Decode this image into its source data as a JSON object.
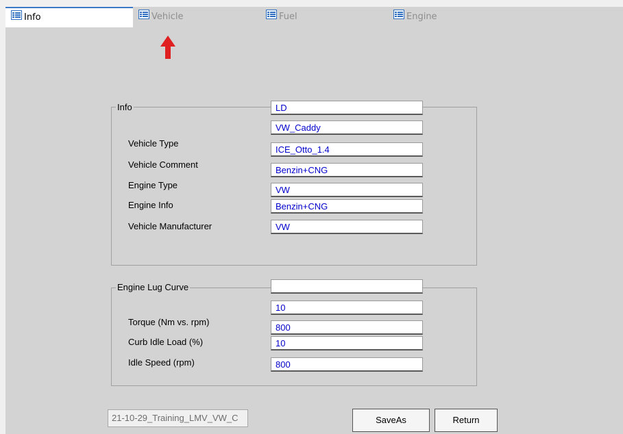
{
  "tabs": [
    {
      "label": "Info",
      "active": true
    },
    {
      "label": "Vehicle",
      "active": false
    },
    {
      "label": "Fuel",
      "active": false
    },
    {
      "label": "Engine",
      "active": false
    }
  ],
  "info_group": {
    "legend": "Info",
    "labels": [
      "Vehicle Type",
      "Vehicle Comment",
      "Engine Type",
      "Engine Info",
      "Vehicle Manufacturer"
    ],
    "values": [
      "LD",
      "VW_Caddy",
      "ICE_Otto_1.4",
      "Benzin+CNG",
      "VW",
      "Benzin+CNG",
      "VW"
    ]
  },
  "lug_group": {
    "legend": "Engine Lug Curve",
    "labels": [
      "Torque (Nm vs. rpm)",
      "Curb Idle Load (%)",
      "Idle Speed (rpm)"
    ],
    "values": [
      "",
      "10",
      "800",
      "10",
      "800"
    ]
  },
  "footer": {
    "filename": "21-10-29_Training_LMV_VW_C",
    "saveas_label": "SaveAs",
    "return_label": "Return"
  },
  "colors": {
    "value_text": "#0000cc",
    "active_tab_border": "#3a79c8",
    "arrow": "#e02020"
  },
  "icons": {
    "tab": "list-icon",
    "annotation": "up-arrow-icon"
  }
}
